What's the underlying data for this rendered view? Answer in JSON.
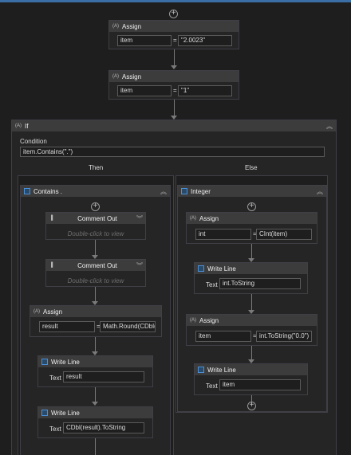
{
  "assign1": {
    "title": "Assign",
    "to": "item",
    "value": "\"2.0023\""
  },
  "assign2": {
    "title": "Assign",
    "to": "item",
    "value": "\"1\""
  },
  "if_activity": {
    "title": "If",
    "condition_label": "Condition",
    "condition": "item.Contains(\".\")",
    "then_label": "Then",
    "else_label": "Else"
  },
  "then_seq": {
    "title": "Contains .",
    "comment1": {
      "title": "Comment Out",
      "hint": "Double-click to view"
    },
    "comment2": {
      "title": "Comment Out",
      "hint": "Double-click to view"
    },
    "assign": {
      "title": "Assign",
      "to": "result",
      "value": "Math.Round(CDbl("
    },
    "writeline1": {
      "title": "Write Line",
      "text_label": "Text",
      "text": "result"
    },
    "writeline2": {
      "title": "Write Line",
      "text_label": "Text",
      "text": "CDbl(result).ToString"
    }
  },
  "else_seq": {
    "title": "Integer",
    "assign1": {
      "title": "Assign",
      "to": "int",
      "value": "CInt(item)"
    },
    "writeline1": {
      "title": "Write Line",
      "text_label": "Text",
      "text": "int.ToString"
    },
    "assign2": {
      "title": "Assign",
      "to": "item",
      "value": "int.ToString(\"0.0\")"
    },
    "writeline2": {
      "title": "Write Line",
      "text_label": "Text",
      "text": "item"
    }
  },
  "eq_symbol": "=",
  "icons": {
    "add": "plus-circle-icon",
    "assign": "assign-icon",
    "collapse": "chevron-up-icon",
    "expand": "chevron-down-icon",
    "sequence": "sequence-icon",
    "comment": "comment-icon",
    "writeline": "write-line-icon",
    "if": "if-icon"
  }
}
